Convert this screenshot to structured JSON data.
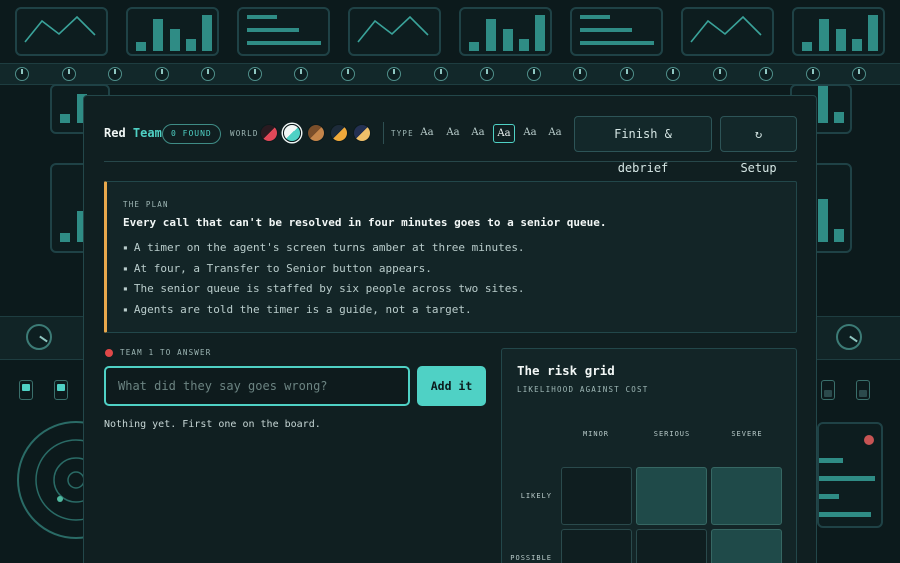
{
  "topbar": {
    "brand_red": "Red",
    "brand_team": "Team",
    "found_badge": "0 FOUND",
    "world_label": "WORLD",
    "type_label": "TYPE",
    "world_swatches": [
      {
        "name": "red",
        "a": "#e04858",
        "b": "#2a1a20",
        "selected": false
      },
      {
        "name": "teal",
        "a": "#4fd1c5",
        "b": "#f2f7f6",
        "selected": true
      },
      {
        "name": "copper",
        "a": "#c4854a",
        "b": "#7a4e2a",
        "selected": false
      },
      {
        "name": "amber",
        "a": "#f0a93a",
        "b": "#1d2b3a",
        "selected": false
      },
      {
        "name": "sand",
        "a": "#efc06a",
        "b": "#233052",
        "selected": false
      }
    ],
    "type_options": [
      "Aa",
      "Aa",
      "Aa",
      "Aa",
      "Aa",
      "Aa"
    ],
    "type_selected_index": 3,
    "finish_label": "Finish & debrief",
    "setup_label": "↻ Setup"
  },
  "plan": {
    "eyebrow": "THE PLAN",
    "headline": "Every call that can't be resolved in four minutes goes to a senior queue.",
    "bullets": [
      "A timer on the agent's screen turns amber at three minutes.",
      "At four, a Transfer to Senior button appears.",
      "The senior queue is staffed by six people across two sites.",
      "Agents are told the timer is a guide, not a target."
    ]
  },
  "answer": {
    "team_label": "TEAM 1 TO ANSWER",
    "placeholder": "What did they say goes wrong?",
    "value": "",
    "add_label": "Add it",
    "empty_note": "Nothing yet. First one on the board."
  },
  "risk_grid": {
    "title": "The risk grid",
    "subtitle": "LIKELIHOOD AGAINST COST",
    "columns": [
      "MINOR",
      "SERIOUS",
      "SEVERE"
    ],
    "rows": [
      "LIKELY",
      "POSSIBLE"
    ]
  },
  "colors": {
    "accent": "#4fd1c5",
    "plan_rule": "#e9a84c",
    "team_dot": "#e04848"
  }
}
